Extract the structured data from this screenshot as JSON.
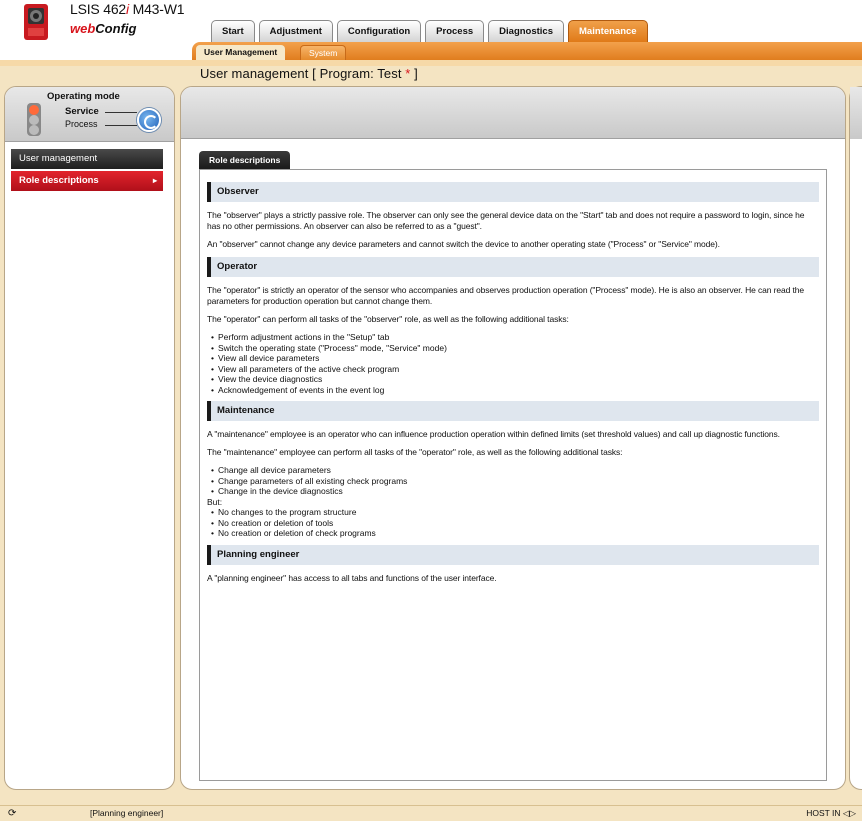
{
  "header": {
    "device_name": "LSIS 462",
    "device_name_italic": "i",
    "device_name_suffix": " M43-W1",
    "brand_web": "web",
    "brand_config": "Config"
  },
  "tabs": [
    {
      "label": "Start",
      "active": false
    },
    {
      "label": "Adjustment",
      "active": false
    },
    {
      "label": "Configuration",
      "active": false
    },
    {
      "label": "Process",
      "active": false
    },
    {
      "label": "Diagnostics",
      "active": false
    },
    {
      "label": "Maintenance",
      "active": true
    }
  ],
  "subtabs": {
    "user_management": "User Management",
    "system": "System"
  },
  "page_title": {
    "text": "User management   [ Program: Test ",
    "star": "*",
    "close": " ]"
  },
  "operating_mode": {
    "title": "Operating mode",
    "service": "Service",
    "process": "Process"
  },
  "nav": {
    "user_management": "User management",
    "role_descriptions": "Role descriptions",
    "arrow": "▸"
  },
  "content_tab": "Role descriptions",
  "sections": {
    "observer": {
      "title": "Observer",
      "p1": "The \"observer\" plays a strictly passive role. The observer can only see the general device data on the \"Start\" tab and does not require a password to login, since he has no other permissions. An observer can also be referred to as a \"guest\".",
      "p2": "An \"observer\" cannot change any device parameters and cannot switch the device to another operating state (\"Process\" or \"Service\" mode)."
    },
    "operator": {
      "title": "Operator",
      "p1": "The \"operator\" is strictly an operator of the sensor who accompanies and observes production operation (\"Process\" mode). He is also an observer. He can read the parameters for production operation but cannot change them.",
      "p2": "The \"operator\" can perform all tasks of the \"observer\" role, as well as the following additional tasks:",
      "bullets": [
        "Perform adjustment actions in the \"Setup\" tab",
        "Switch the operating state (\"Process\" mode, \"Service\" mode)",
        "View all device parameters",
        "View all parameters of the active check program",
        "View the device diagnostics",
        "Acknowledgement of events in the event log"
      ]
    },
    "maintenance": {
      "title": "Maintenance",
      "p1": "A \"maintenance\" employee is an operator who can influence production operation within defined limits (set threshold values) and call up diagnostic functions.",
      "p2": "The \"maintenance\" employee can perform all tasks of the \"operator\" role, as well as the following additional tasks:",
      "bullets": [
        "Change all device parameters",
        "Change parameters of all existing check programs",
        "Change in the device diagnostics"
      ],
      "but": "But:",
      "bullets_but": [
        "No changes to the program structure",
        "No creation or deletion of tools",
        "No creation or deletion of check programs"
      ]
    },
    "planning": {
      "title": "Planning engineer",
      "p1": "A \"planning engineer\" has access to all tabs and functions of the user interface."
    }
  },
  "status_bar": {
    "refresh_icon": "refresh-icon",
    "role": "[Planning engineer]",
    "host": "HOST IN ◁▷"
  },
  "colors": {
    "accent_orange": "#e07a18",
    "brand_red": "#d8141c",
    "background": "#f4e4c2"
  }
}
